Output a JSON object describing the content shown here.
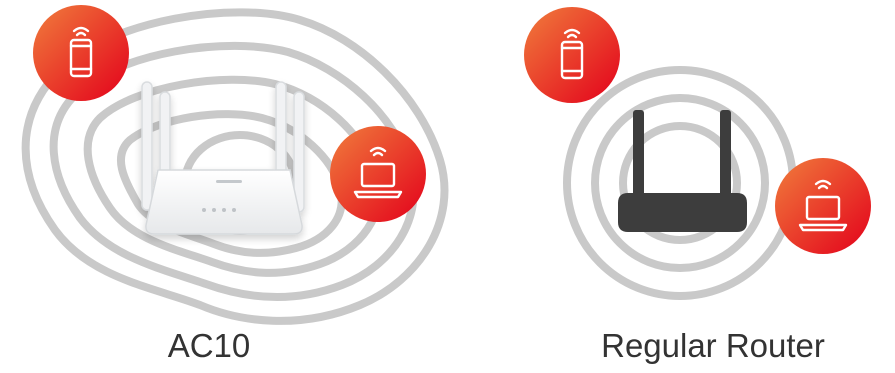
{
  "comparison": {
    "left": {
      "caption": "AC10",
      "device": "white-router-with-four-antennas",
      "devices": [
        "smartphone-icon",
        "laptop-icon"
      ]
    },
    "right": {
      "caption": "Regular Router",
      "device": "black-router-with-two-antennas",
      "devices": [
        "smartphone-icon",
        "laptop-icon"
      ]
    }
  },
  "colors": {
    "badge_gradient_start": "#f07d3c",
    "badge_gradient_end": "#e3001b",
    "wave_line": "#c9c9c9",
    "regular_router_body": "#3d3d3d",
    "ac10_router_body": "#f4f5f6",
    "caption_text": "#333333"
  }
}
